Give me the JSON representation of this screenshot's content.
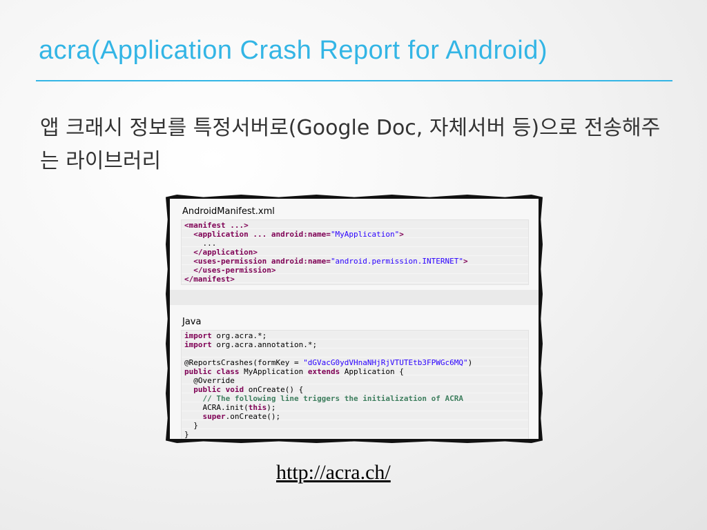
{
  "slide": {
    "title": "acra(Application Crash Report for Android)",
    "description": "앱 크래시 정보를 특정서버로(Google Doc, 자체서버 등)으로 전송해주는 라이브러리",
    "link": "http://acra.ch/"
  },
  "manifest": {
    "heading": "AndroidManifest.xml",
    "lines": [
      {
        "indent": "",
        "parts": [
          {
            "t": "<manifest ...>",
            "k": "kw"
          }
        ]
      },
      {
        "indent": "  ",
        "parts": [
          {
            "t": "<application ... android:name=",
            "k": "kw"
          },
          {
            "t": "\"MyApplication\"",
            "k": "str"
          },
          {
            "t": ">",
            "k": "kw"
          }
        ]
      },
      {
        "indent": "    ",
        "parts": [
          {
            "t": "...",
            "k": "plain"
          }
        ]
      },
      {
        "indent": "  ",
        "parts": [
          {
            "t": "</application>",
            "k": "kw"
          }
        ]
      },
      {
        "indent": "  ",
        "parts": [
          {
            "t": "<uses-permission android:name=",
            "k": "kw"
          },
          {
            "t": "\"android.permission.INTERNET\"",
            "k": "str"
          },
          {
            "t": ">",
            "k": "kw"
          }
        ]
      },
      {
        "indent": "  ",
        "parts": [
          {
            "t": "</uses-permission>",
            "k": "kw"
          }
        ]
      },
      {
        "indent": "",
        "parts": [
          {
            "t": "</manifest>",
            "k": "kw"
          }
        ]
      }
    ]
  },
  "java": {
    "heading": "Java",
    "lines": [
      {
        "indent": "",
        "parts": [
          {
            "t": "import",
            "k": "kw"
          },
          {
            "t": " org.acra.*;",
            "k": "plain"
          }
        ]
      },
      {
        "indent": "",
        "parts": [
          {
            "t": "import",
            "k": "kw"
          },
          {
            "t": " org.acra.annotation.*;",
            "k": "plain"
          }
        ]
      },
      {
        "indent": "",
        "parts": [
          {
            "t": "",
            "k": "plain"
          }
        ]
      },
      {
        "indent": "",
        "parts": [
          {
            "t": "@ReportsCrashes(formKey = ",
            "k": "plain"
          },
          {
            "t": "\"dGVacG0ydVHnaNHjRjVTUTEtb3FPWGc6MQ\"",
            "k": "str"
          },
          {
            "t": ")",
            "k": "plain"
          }
        ]
      },
      {
        "indent": "",
        "parts": [
          {
            "t": "public class",
            "k": "kw"
          },
          {
            "t": " MyApplication ",
            "k": "plain"
          },
          {
            "t": "extends",
            "k": "kw"
          },
          {
            "t": " Application {",
            "k": "plain"
          }
        ]
      },
      {
        "indent": "  ",
        "parts": [
          {
            "t": "@Override",
            "k": "plain"
          }
        ]
      },
      {
        "indent": "  ",
        "parts": [
          {
            "t": "public void",
            "k": "kw"
          },
          {
            "t": " onCreate() {",
            "k": "plain"
          }
        ]
      },
      {
        "indent": "    ",
        "parts": [
          {
            "t": "// The following line triggers the initialization of ACRA",
            "k": "cm"
          }
        ]
      },
      {
        "indent": "    ",
        "parts": [
          {
            "t": "ACRA.init(",
            "k": "plain"
          },
          {
            "t": "this",
            "k": "kw"
          },
          {
            "t": ");",
            "k": "plain"
          }
        ]
      },
      {
        "indent": "    ",
        "parts": [
          {
            "t": "super",
            "k": "kw"
          },
          {
            "t": ".onCreate();",
            "k": "plain"
          }
        ]
      },
      {
        "indent": "  ",
        "parts": [
          {
            "t": "}",
            "k": "plain"
          }
        ]
      },
      {
        "indent": "",
        "parts": [
          {
            "t": "}",
            "k": "plain"
          }
        ]
      }
    ]
  }
}
